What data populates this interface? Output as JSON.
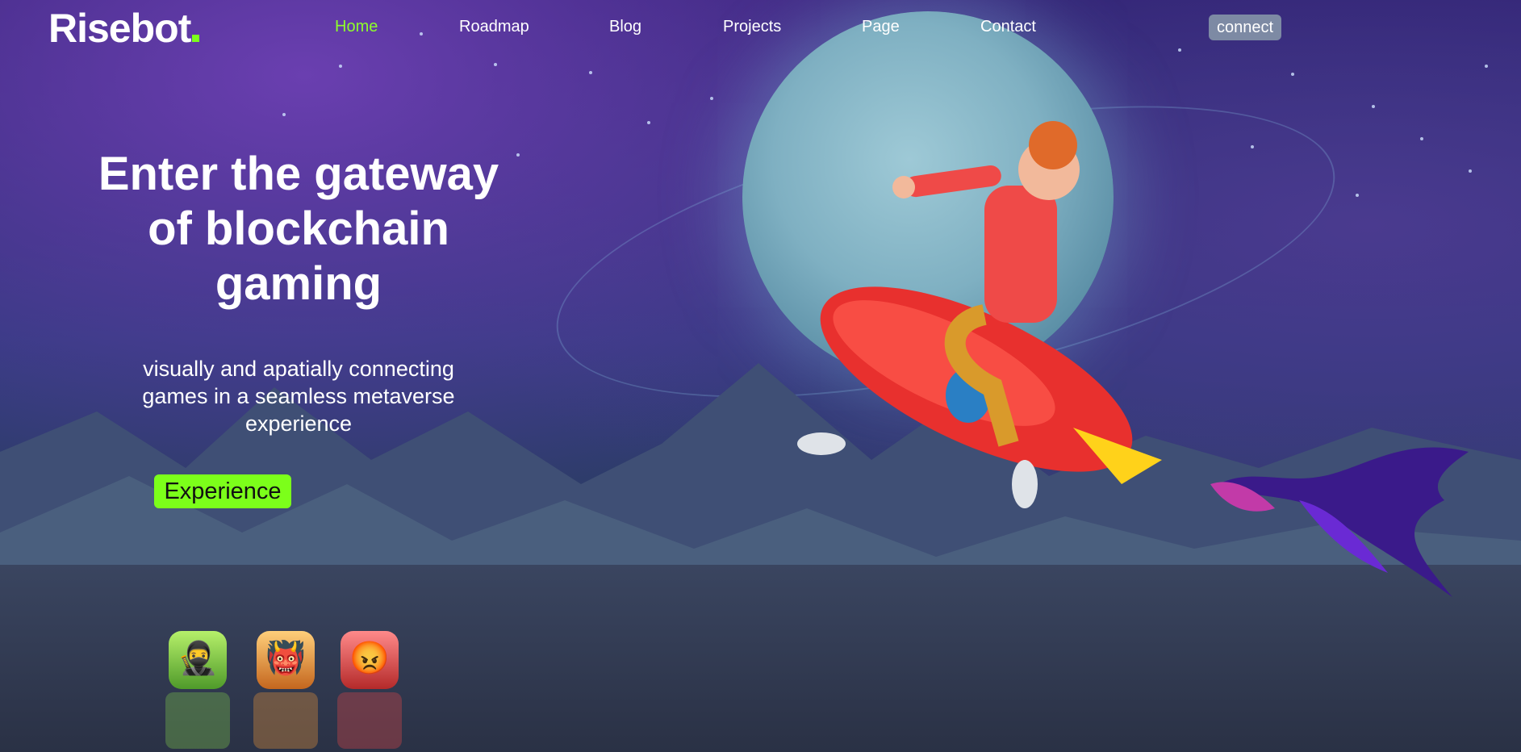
{
  "brand": {
    "name": "Risebot"
  },
  "nav": {
    "items": [
      {
        "label": "Home",
        "active": true
      },
      {
        "label": "Roadmap",
        "active": false
      },
      {
        "label": "Blog",
        "active": false
      },
      {
        "label": "Projects",
        "active": false
      },
      {
        "label": "Page",
        "active": false
      },
      {
        "label": "Contact",
        "active": false
      }
    ],
    "connect_label": "connect"
  },
  "hero": {
    "title_lines": [
      "Enter the gateway",
      "of blockchain",
      "gaming"
    ],
    "subtitle_lines": [
      "visually and apatially connecting",
      "games in a seamless metaverse",
      "experience"
    ],
    "cta_label": "Experience"
  },
  "game_tiles": [
    {
      "icon": "ninja-icon",
      "color": "#7ec84a"
    },
    {
      "icon": "ogre-icon",
      "color": "#e8963a"
    },
    {
      "icon": "warrior-icon",
      "color": "#e04848"
    }
  ],
  "colors": {
    "accent": "#7cff1a",
    "active_nav": "#8dff2a",
    "connect_bg": "#7d8aa4"
  }
}
